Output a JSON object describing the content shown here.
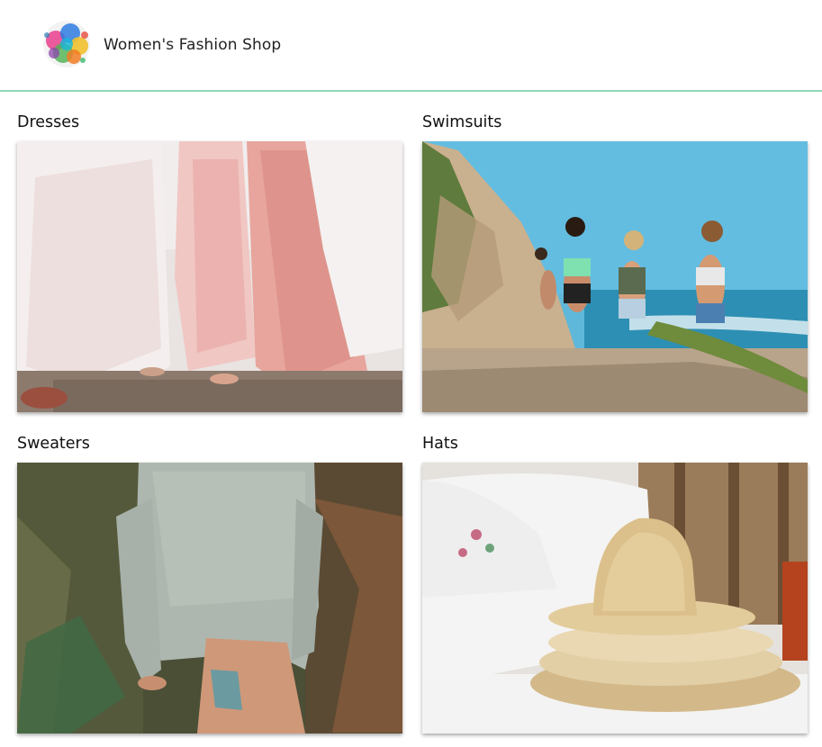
{
  "header": {
    "brand_name": "Women's Fashion Shop",
    "logo_icon": "paint-splash-logo-icon",
    "accent_color": "#8fd6b8"
  },
  "categories": [
    {
      "title": "Dresses",
      "image": "dresses-photo"
    },
    {
      "title": "Swimsuits",
      "image": "swimsuits-photo"
    },
    {
      "title": "Sweaters",
      "image": "sweaters-photo"
    },
    {
      "title": "Hats",
      "image": "hats-photo"
    }
  ]
}
